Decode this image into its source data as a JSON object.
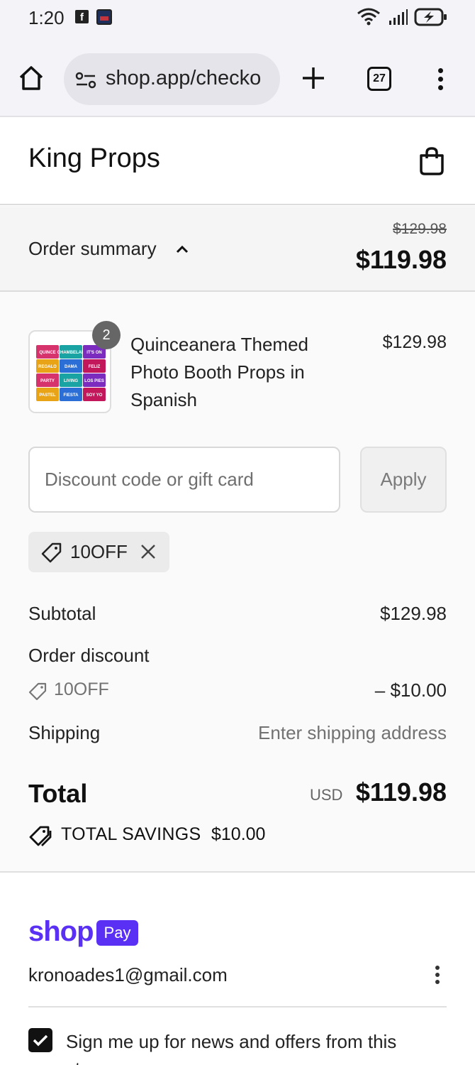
{
  "status_bar": {
    "time": "1:20",
    "fb_glyph": "f",
    "icons": [
      "facebook-icon",
      "app-notification-icon",
      "wifi-icon",
      "signal-icon",
      "battery-charging-icon"
    ]
  },
  "browser": {
    "url": "shop.app/checko",
    "tab_count": "27",
    "icons": [
      "home-icon",
      "tune-icon",
      "new-tab-icon",
      "menu-icon"
    ]
  },
  "store": {
    "name": "King Props",
    "icon": "shopping-bag-icon"
  },
  "order_summary": {
    "label": "Order summary",
    "original_total": "$129.98",
    "total": "$119.98"
  },
  "line_item": {
    "quantity": "2",
    "name": "Quinceanera Themed Photo Booth Props in Spanish",
    "price": "$129.98",
    "thumbnail_words": [
      "QUINCE",
      "CHAMBELAN",
      "IT'S ON",
      "REGALO",
      "DAMA",
      "FELIZ",
      "PARTY",
      "LIVING",
      "LOS PIES",
      "PASTEL",
      "FIESTA",
      "SOY YO"
    ]
  },
  "discount": {
    "placeholder": "Discount code or gift card",
    "apply_label": "Apply",
    "applied_code": "10OFF"
  },
  "costs": {
    "subtotal_label": "Subtotal",
    "subtotal_value": "$129.98",
    "order_discount_label": "Order discount",
    "discount_code": "10OFF",
    "discount_value": "– $10.00",
    "shipping_label": "Shipping",
    "shipping_value": "Enter shipping address",
    "total_label": "Total",
    "currency": "USD",
    "total_value": "$119.98",
    "savings_label": "TOTAL SAVINGS",
    "savings_value": "$10.00"
  },
  "shop_pay": {
    "logo_text": "shop",
    "badge_text": "Pay",
    "email": "kronoades1@gmail.com",
    "newsletter_label": "Sign me up for news and offers from this store",
    "newsletter_checked": true,
    "brand_color": "#5a31f4"
  }
}
